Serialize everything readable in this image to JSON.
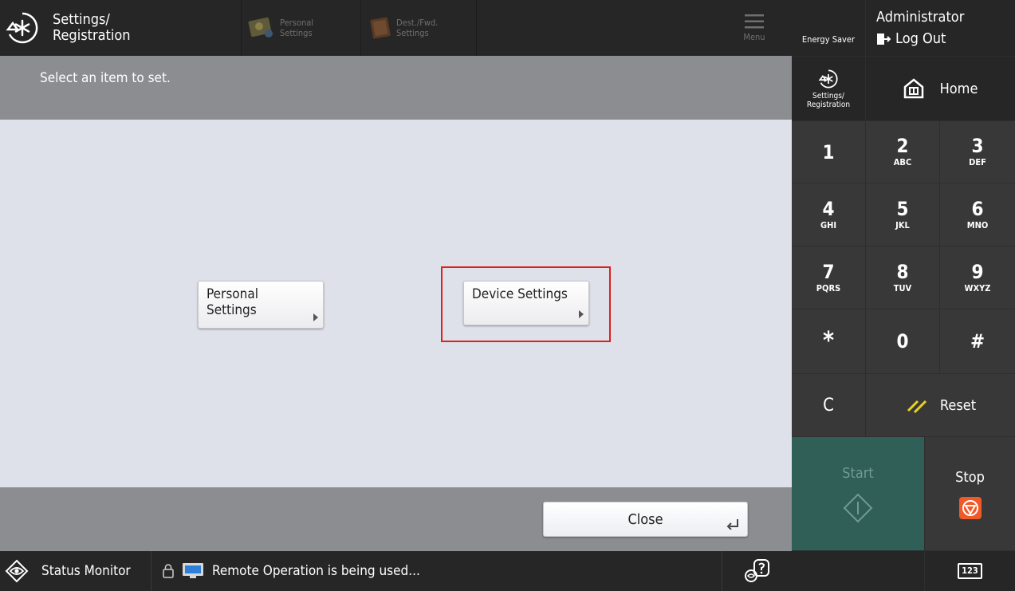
{
  "topbar": {
    "title_line1": "Settings/",
    "title_line2": "Registration",
    "shortcut_personal_line1": "Personal",
    "shortcut_personal_line2": "Settings",
    "shortcut_dest_line1": "Dest./Fwd.",
    "shortcut_dest_line2": "Settings",
    "menu_label": "Menu"
  },
  "prompt": "Select an item to set.",
  "main": {
    "personal_line1": "Personal",
    "personal_line2": "Settings",
    "device_label": "Device Settings"
  },
  "bottom": {
    "close_label": "Close"
  },
  "statusbar": {
    "status_monitor": "Status Monitor",
    "remote_text": "Remote Operation is being used..."
  },
  "right": {
    "energy_saver": "Energy Saver",
    "user": "Administrator",
    "logout": "Log Out",
    "settings_line1": "Settings/",
    "settings_line2": "Registration",
    "home": "Home",
    "keys": [
      {
        "key": "1",
        "sub": ""
      },
      {
        "key": "2",
        "sub": "ABC"
      },
      {
        "key": "3",
        "sub": "DEF"
      },
      {
        "key": "4",
        "sub": "GHI"
      },
      {
        "key": "5",
        "sub": "JKL"
      },
      {
        "key": "6",
        "sub": "MNO"
      },
      {
        "key": "7",
        "sub": "PQRS"
      },
      {
        "key": "8",
        "sub": "TUV"
      },
      {
        "key": "9",
        "sub": "WXYZ"
      },
      {
        "key": "*",
        "sub": ""
      },
      {
        "key": "0",
        "sub": ""
      },
      {
        "key": "#",
        "sub": ""
      }
    ],
    "clear": "C",
    "reset": "Reset",
    "start": "Start",
    "stop": "Stop",
    "numeric_icon": "123"
  },
  "colors": {
    "highlight": "#e0201c",
    "start_bg": "#2f5f57",
    "stop_icon": "#f05a28",
    "reset_icon": "#e8d21c"
  }
}
